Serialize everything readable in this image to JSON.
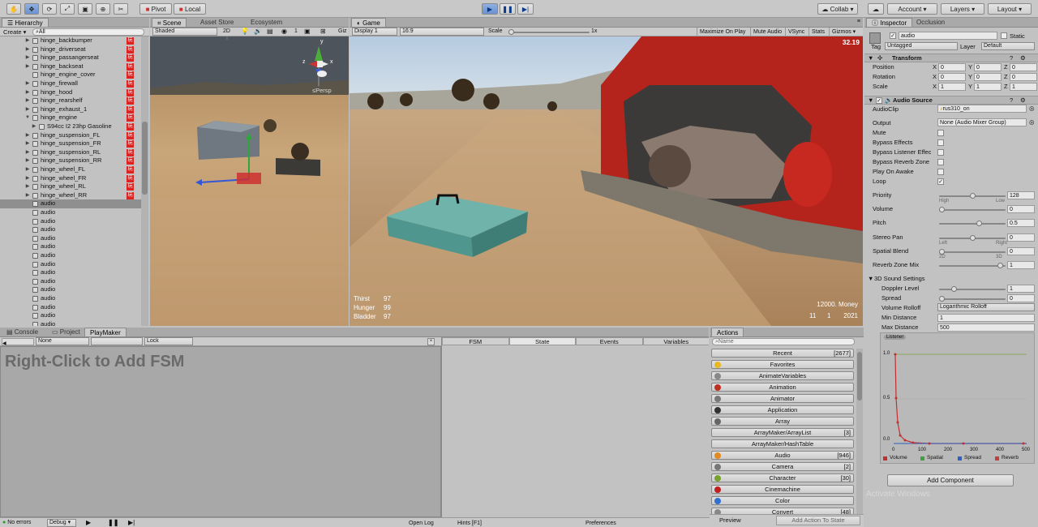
{
  "toolbar": {
    "pivot_label": "Pivot",
    "local_label": "Local",
    "collab_label": "Collab",
    "account_label": "Account",
    "layers_label": "Layers",
    "layout_label": "Layout"
  },
  "hierarchy": {
    "tab_label": "Hierarchy",
    "create_label": "Create",
    "search_text": "All",
    "rows": [
      {
        "label": "hinge_backbumper",
        "arrow": "▶",
        "badge": "玩"
      },
      {
        "label": "hinge_driverseat",
        "arrow": "▶",
        "badge": "玩"
      },
      {
        "label": "hinge_passangerseat",
        "arrow": "▶",
        "badge": "玩"
      },
      {
        "label": "hinge_backseat",
        "arrow": "▶",
        "badge": "玩"
      },
      {
        "label": "hinge_engine_cover",
        "arrow": "",
        "badge": "玩"
      },
      {
        "label": "hinge_firewall",
        "arrow": "▶",
        "badge": "玩"
      },
      {
        "label": "hinge_hood",
        "arrow": "▶",
        "badge": "玩"
      },
      {
        "label": "hinge_rearshelf",
        "arrow": "▶",
        "badge": "玩"
      },
      {
        "label": "hinge_exhaust_1",
        "arrow": "▶",
        "badge": "玩"
      },
      {
        "label": "hinge_engine",
        "arrow": "▼",
        "badge": "玩"
      },
      {
        "label": "S94cc I2 23hp Gasoline",
        "arrow": "▶",
        "badge": "玩",
        "indent": true
      },
      {
        "label": "hinge_suspension_FL",
        "arrow": "▶",
        "badge": "玩"
      },
      {
        "label": "hinge_suspension_FR",
        "arrow": "▶",
        "badge": "玩"
      },
      {
        "label": "hinge_suspension_RL",
        "arrow": "▶",
        "badge": "玩"
      },
      {
        "label": "hinge_suspension_RR",
        "arrow": "▶",
        "badge": "玩"
      },
      {
        "label": "hinge_wheel_FL",
        "arrow": "▶",
        "badge": "玩"
      },
      {
        "label": "hinge_wheel_FR",
        "arrow": "▶",
        "badge": "玩"
      },
      {
        "label": "hinge_wheel_RL",
        "arrow": "▶",
        "badge": "玩"
      },
      {
        "label": "hinge_wheel_RR",
        "arrow": "▶",
        "badge": "玩"
      },
      {
        "label": "audio",
        "arrow": "",
        "badge": "",
        "selected": true
      },
      {
        "label": "audio",
        "arrow": "",
        "badge": ""
      },
      {
        "label": "audio",
        "arrow": "",
        "badge": ""
      },
      {
        "label": "audio",
        "arrow": "",
        "badge": ""
      },
      {
        "label": "audio",
        "arrow": "",
        "badge": ""
      },
      {
        "label": "audio",
        "arrow": "",
        "badge": ""
      },
      {
        "label": "audio",
        "arrow": "",
        "badge": ""
      },
      {
        "label": "audio",
        "arrow": "",
        "badge": ""
      },
      {
        "label": "audio",
        "arrow": "",
        "badge": ""
      },
      {
        "label": "audio",
        "arrow": "",
        "badge": ""
      },
      {
        "label": "audio",
        "arrow": "",
        "badge": ""
      },
      {
        "label": "audio",
        "arrow": "",
        "badge": ""
      },
      {
        "label": "audio",
        "arrow": "",
        "badge": ""
      },
      {
        "label": "audio",
        "arrow": "",
        "badge": ""
      },
      {
        "label": "audio",
        "arrow": "",
        "badge": ""
      }
    ]
  },
  "scene": {
    "tabs": [
      "Scene",
      "Asset Store",
      "Ecosystem"
    ],
    "shading": "Shaded",
    "mode_2d": "2D",
    "gizmo_count": "1",
    "gizmos_short": "Giz",
    "persp_label": "Persp",
    "axis_y": "y",
    "axis_x": "x",
    "axis_z": "z"
  },
  "game": {
    "tab_label": "Game",
    "display": "Display 1",
    "aspect": "16:9",
    "scale_label": "Scale",
    "scale_value": "1x",
    "maximize_label": "Maximize On Play",
    "mute_label": "Mute Audio",
    "vsync_label": "VSync",
    "stats_label": "Stats",
    "gizmos_label": "Gizmos",
    "fps": "32.19",
    "hud_left": [
      {
        "label": "Thirst",
        "value": "97"
      },
      {
        "label": "Hunger",
        "value": "99"
      },
      {
        "label": "Bladder",
        "value": "97"
      }
    ],
    "money": "12000. Money",
    "date_day": "11",
    "date_month": "1",
    "date_year": "2021"
  },
  "bottom_tabs": [
    "Console",
    "Project",
    "PlayMaker"
  ],
  "playmaker": {
    "none_label": "None",
    "lock_label": "Lock",
    "big_text": "Right-Click to Add FSM",
    "columns": [
      "FSM",
      "State",
      "Events",
      "Variables"
    ]
  },
  "actions": {
    "tab_label": "Actions",
    "search_placeholder": "Name",
    "items": [
      {
        "label": "Recent",
        "count": "[2677]",
        "icon": ""
      },
      {
        "label": "Favorites",
        "count": "",
        "icon": "#e8b820"
      },
      {
        "label": "AnimateVariables",
        "count": "",
        "icon": "#888888"
      },
      {
        "label": "Animation",
        "count": "",
        "icon": "#c03020"
      },
      {
        "label": "Animator",
        "count": "",
        "icon": "#777777"
      },
      {
        "label": "Application",
        "count": "",
        "icon": "#333333"
      },
      {
        "label": "Array",
        "count": "",
        "icon": "#666666"
      },
      {
        "label": "ArrayMaker/ArrayList",
        "count": "[3]",
        "icon": ""
      },
      {
        "label": "ArrayMaker/HashTable",
        "count": "",
        "icon": ""
      },
      {
        "label": "Audio",
        "count": "[946]",
        "icon": "#e08a20"
      },
      {
        "label": "Camera",
        "count": "[2]",
        "icon": "#777777"
      },
      {
        "label": "Character",
        "count": "[30]",
        "icon": "#7aa030"
      },
      {
        "label": "Cinemachine",
        "count": "",
        "icon": "#c02020"
      },
      {
        "label": "Color",
        "count": "",
        "icon": "#3070d0"
      },
      {
        "label": "Convert",
        "count": "[48]",
        "icon": "#888888"
      }
    ],
    "preview_label": "Preview",
    "add_action_label": "Add Action To State"
  },
  "inspector": {
    "tabs": [
      "Inspector",
      "Occlusion"
    ],
    "object_name": "audio",
    "static_label": "Static",
    "tag_label": "Tag",
    "tag_value": "Untagged",
    "layer_label": "Layer",
    "layer_value": "Default",
    "transform": {
      "title": "Transform",
      "rows": [
        {
          "label": "Position",
          "x": "0",
          "y": "0",
          "z": "0"
        },
        {
          "label": "Rotation",
          "x": "0",
          "y": "0",
          "z": "0"
        },
        {
          "label": "Scale",
          "x": "1",
          "y": "1",
          "z": "1"
        }
      ],
      "axis_x": "X",
      "axis_y": "Y",
      "axis_z": "Z"
    },
    "audio_source": {
      "title": "Audio Source",
      "audioclip_label": "AudioClip",
      "audioclip_value": "rus310_on",
      "output_label": "Output",
      "output_value": "None (Audio Mixer Group)",
      "checks": [
        {
          "label": "Mute",
          "checked": false
        },
        {
          "label": "Bypass Effects",
          "checked": false
        },
        {
          "label": "Bypass Listener Effec",
          "checked": false
        },
        {
          "label": "Bypass Reverb Zone",
          "checked": false
        },
        {
          "label": "Play On Awake",
          "checked": false
        },
        {
          "label": "Loop",
          "checked": true
        }
      ],
      "sliders": [
        {
          "label": "Priority",
          "value": "128",
          "pos": 0.5,
          "left": "High",
          "right": "Low"
        },
        {
          "label": "Volume",
          "value": "0",
          "pos": 0.0
        },
        {
          "label": "Pitch",
          "value": "0.5",
          "pos": 0.6
        },
        {
          "label": "Stereo Pan",
          "value": "0",
          "pos": 0.5,
          "left": "Left",
          "right": "Right"
        },
        {
          "label": "Spatial Blend",
          "value": "0",
          "pos": 0.0,
          "left": "2D",
          "right": "3D"
        },
        {
          "label": "Reverb Zone Mix",
          "value": "1",
          "pos": 0.95
        }
      ],
      "sound3d": {
        "title": "3D Sound Settings",
        "doppler_label": "Doppler Level",
        "doppler_value": "1",
        "doppler_pos": 0.2,
        "spread_label": "Spread",
        "spread_value": "0",
        "spread_pos": 0.0,
        "rolloff_label": "Volume Rolloff",
        "rolloff_value": "Logarithmic Rolloff",
        "min_label": "Min Distance",
        "min_value": "1",
        "max_label": "Max Distance",
        "max_value": "500"
      }
    },
    "graph": {
      "badge": "Listener",
      "y_ticks": [
        "1.0",
        "0.5",
        "0.0"
      ],
      "x_ticks": [
        "0",
        "100",
        "200",
        "300",
        "400",
        "500"
      ],
      "legend": [
        {
          "name": "Volume",
          "color": "#c03030"
        },
        {
          "name": "Spatial",
          "color": "#40a040"
        },
        {
          "name": "Spread",
          "color": "#3060c0"
        },
        {
          "name": "Reverb",
          "color": "#c04040"
        }
      ]
    },
    "add_component_label": "Add Component",
    "watermark": "Activate Windows"
  },
  "status": {
    "errors": "No errors",
    "debug": "Debug",
    "open_log": "Open Log",
    "hints": "Hints [F1]",
    "preferences": "Preferences"
  }
}
